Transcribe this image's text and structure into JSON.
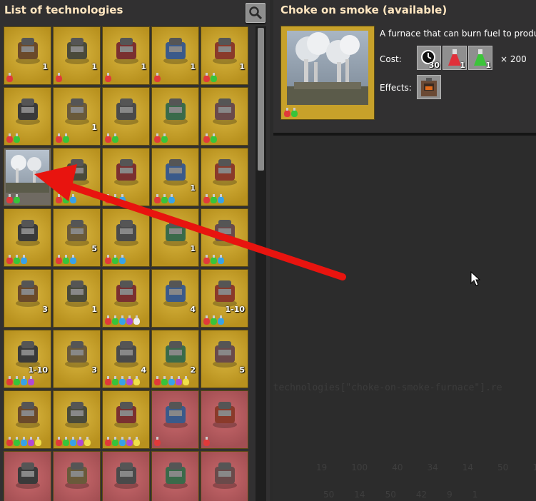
{
  "left_panel": {
    "title": "List of technologies"
  },
  "grid": {
    "cells": [
      {
        "style": "yellow",
        "badge": "1",
        "flasks": [
          "r"
        ]
      },
      {
        "style": "yellow",
        "badge": "1",
        "flasks": [
          "r"
        ]
      },
      {
        "style": "yellow",
        "badge": "1",
        "flasks": [
          "r"
        ]
      },
      {
        "style": "yellow",
        "badge": "1",
        "flasks": [
          "r"
        ]
      },
      {
        "style": "yellow",
        "badge": "1",
        "flasks": [
          "r",
          "g"
        ]
      },
      {
        "style": "yellow",
        "badge": "",
        "flasks": [
          "r",
          "g"
        ]
      },
      {
        "style": "yellow",
        "badge": "1",
        "flasks": [
          "r",
          "g"
        ]
      },
      {
        "style": "yellow",
        "badge": "",
        "flasks": [
          "r",
          "g"
        ]
      },
      {
        "style": "yellow",
        "badge": "",
        "flasks": [
          "r",
          "g"
        ]
      },
      {
        "style": "yellow",
        "badge": "",
        "flasks": [
          "r",
          "g"
        ]
      },
      {
        "style": "selected",
        "badge": "",
        "flasks": [
          "r",
          "g"
        ]
      },
      {
        "style": "yellow",
        "badge": "",
        "flasks": [
          "r",
          "g",
          "b"
        ]
      },
      {
        "style": "yellow",
        "badge": "",
        "flasks": [
          "r",
          "g",
          "b"
        ]
      },
      {
        "style": "yellow",
        "badge": "1",
        "flasks": [
          "r",
          "g",
          "b"
        ]
      },
      {
        "style": "yellow",
        "badge": "",
        "flasks": [
          "r",
          "g",
          "b"
        ]
      },
      {
        "style": "yellow",
        "badge": "",
        "flasks": [
          "r",
          "g",
          "b"
        ]
      },
      {
        "style": "yellow",
        "badge": "5",
        "flasks": [
          "r",
          "g",
          "b"
        ]
      },
      {
        "style": "yellow",
        "badge": "",
        "flasks": [
          "r",
          "g",
          "b"
        ]
      },
      {
        "style": "yellow",
        "badge": "1",
        "flasks": []
      },
      {
        "style": "yellow",
        "badge": "",
        "flasks": [
          "r",
          "g",
          "b"
        ]
      },
      {
        "style": "yellow",
        "badge": "3",
        "flasks": []
      },
      {
        "style": "yellow",
        "badge": "1",
        "flasks": []
      },
      {
        "style": "yellow",
        "badge": "",
        "flasks": [
          "r",
          "g",
          "b",
          "p",
          "w"
        ]
      },
      {
        "style": "yellow",
        "badge": "4",
        "flasks": []
      },
      {
        "style": "yellow",
        "badge": "1-10",
        "flasks": [
          "r",
          "g",
          "b"
        ]
      },
      {
        "style": "yellow",
        "badge": "1-10",
        "flasks": [
          "r",
          "g",
          "b",
          "p"
        ]
      },
      {
        "style": "yellow",
        "badge": "3",
        "flasks": []
      },
      {
        "style": "yellow",
        "badge": "4",
        "flasks": [
          "r",
          "g",
          "b",
          "p",
          "y"
        ]
      },
      {
        "style": "yellow",
        "badge": "2",
        "flasks": [
          "r",
          "g",
          "b",
          "p",
          "y"
        ]
      },
      {
        "style": "yellow",
        "badge": "5",
        "flasks": []
      },
      {
        "style": "yellow",
        "badge": "",
        "flasks": [
          "r",
          "g",
          "b",
          "p",
          "y"
        ]
      },
      {
        "style": "yellow",
        "badge": "",
        "flasks": [
          "r",
          "g",
          "b",
          "p",
          "y"
        ]
      },
      {
        "style": "yellow",
        "badge": "",
        "flasks": [
          "r",
          "g",
          "b",
          "p",
          "y"
        ]
      },
      {
        "style": "red",
        "badge": "",
        "flasks": [
          "r"
        ]
      },
      {
        "style": "red",
        "badge": "",
        "flasks": [
          "r"
        ]
      },
      {
        "style": "red",
        "badge": "",
        "flasks": []
      },
      {
        "style": "red",
        "badge": "",
        "flasks": []
      },
      {
        "style": "red",
        "badge": "",
        "flasks": []
      },
      {
        "style": "red",
        "badge": "",
        "flasks": []
      },
      {
        "style": "red",
        "badge": "",
        "flasks": []
      }
    ]
  },
  "detail": {
    "title": "Choke on smoke (available)",
    "description": "A furnace that can burn fuel to produc",
    "cost_label": "Cost:",
    "effects_label": "Effects:",
    "cost": [
      {
        "icon": "time-icon",
        "amount": "30"
      },
      {
        "icon": "red-science-flask-icon",
        "amount": "1"
      },
      {
        "icon": "green-science-flask-icon",
        "amount": "1"
      }
    ],
    "multiplier": "× 200",
    "preview_flasks": [
      "r",
      "g"
    ]
  },
  "background_world": {
    "console_text": "e.technologies[\"choke-on-smoke-furnace\"].re",
    "numbers_row1": [
      "19",
      "100",
      "40",
      "34",
      "14",
      "50",
      "13"
    ],
    "numbers_row2": [
      "50",
      "14",
      "50",
      "42",
      "9",
      "1"
    ]
  },
  "colors": {
    "title_text": "#ffe6c0",
    "tile_yellow": "#c7a12a",
    "tile_red": "#b75a5e",
    "arrow": "#e8140f"
  }
}
